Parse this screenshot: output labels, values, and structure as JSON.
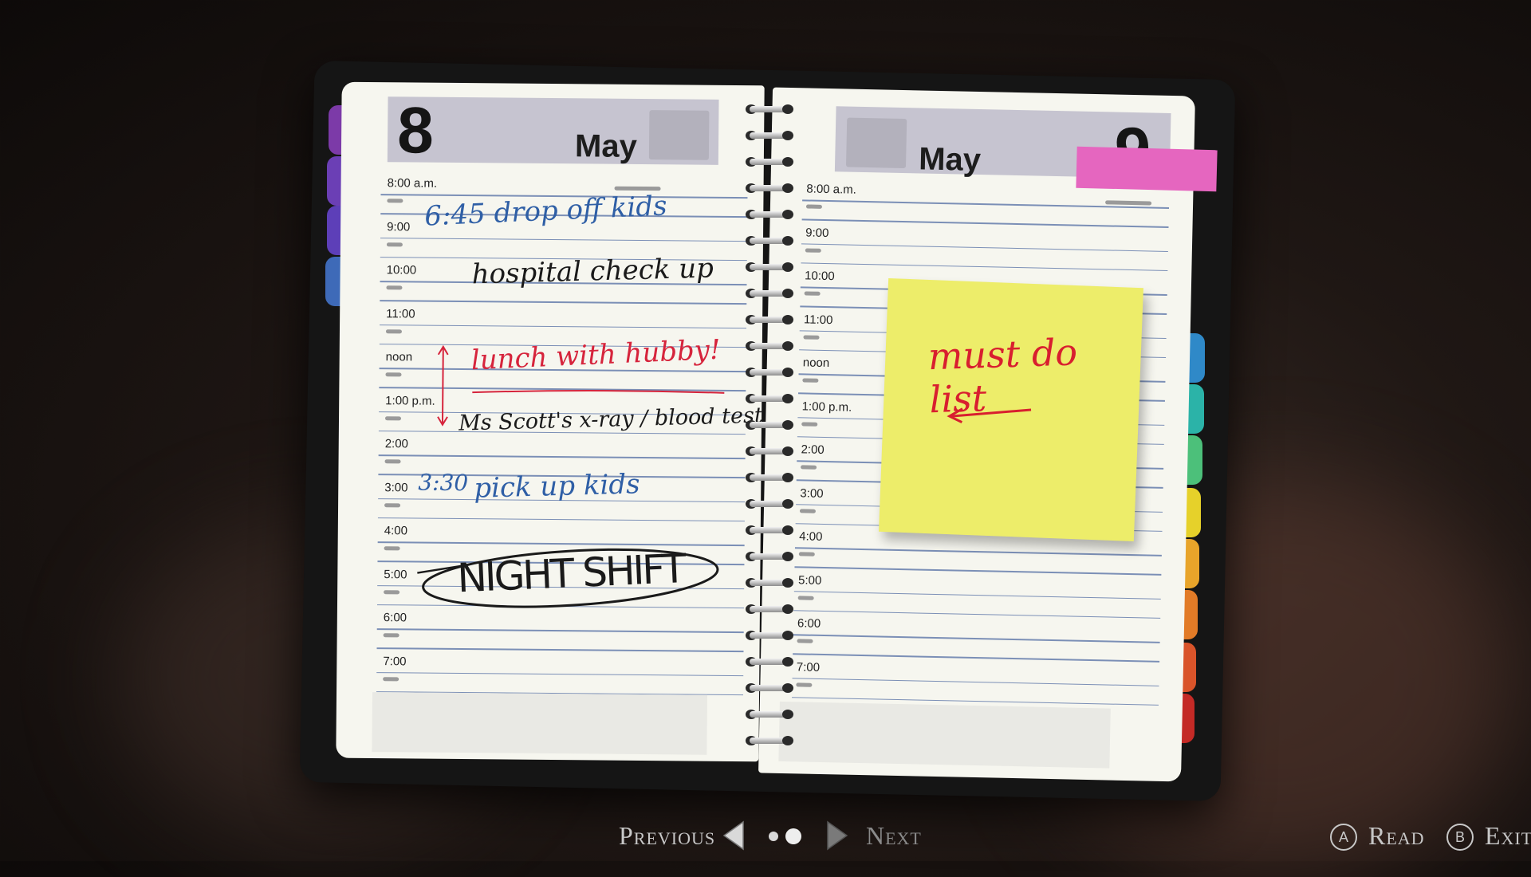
{
  "left_page": {
    "day": "8",
    "month": "May",
    "times": [
      "8:00 a.m.",
      "9:00",
      "10:00",
      "11:00",
      "noon",
      "1:00 p.m.",
      "2:00",
      "3:00",
      "4:00",
      "5:00",
      "6:00",
      "7:00"
    ],
    "entries": {
      "drop_kids": "6:45 drop off kids",
      "hospital": "hospital check up",
      "lunch": "lunch with hubby!",
      "xray": "Ms Scott's x-ray / blood test",
      "pickup_time": "3:30",
      "pickup": "pick up kids",
      "nightshift": "NIGHT SHIFT"
    }
  },
  "right_page": {
    "day": "9",
    "month": "May",
    "times": [
      "8:00 a.m.",
      "9:00",
      "10:00",
      "11:00",
      "noon",
      "1:00 p.m.",
      "2:00",
      "3:00",
      "4:00",
      "5:00",
      "6:00",
      "7:00"
    ],
    "sticky_note": "must do list"
  },
  "controls": {
    "previous": "Previous",
    "next": "Next",
    "read_key": "A",
    "read": "Read",
    "exit_key": "B",
    "exit": "Exit"
  },
  "colors": {
    "ink_blue": "#2f5fa6",
    "ink_red": "#d6243c",
    "sticky": "#eded6a",
    "tape": "#e566bf",
    "tabs": [
      "#7c3aa8",
      "#6b3fb5",
      "#5d3fb8",
      "#3e6ab8",
      "#2f89c8",
      "#2bb3a8",
      "#4cc07a",
      "#e6d12a",
      "#e8a42a",
      "#e27b27",
      "#d9542a",
      "#c42a26"
    ]
  }
}
